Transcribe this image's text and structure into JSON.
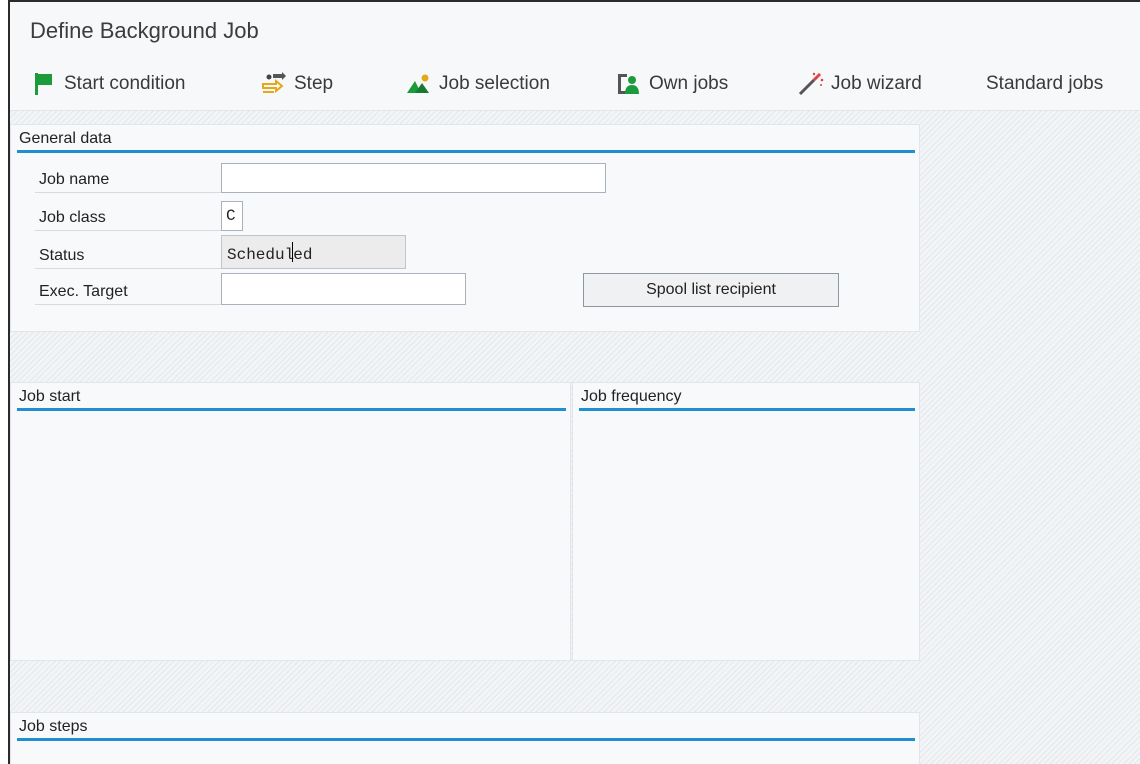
{
  "window": {
    "title": "Define Background Job"
  },
  "toolbar": {
    "start_condition": "Start condition",
    "step": "Step",
    "job_selection": "Job selection",
    "own_jobs": "Own jobs",
    "job_wizard": "Job wizard",
    "standard_jobs": "Standard jobs"
  },
  "general": {
    "heading": "General data",
    "job_name_label": "Job name",
    "job_name_value": "",
    "job_class_label": "Job class",
    "job_class_value": "C",
    "status_label": "Status",
    "status_value_a": "Schedul",
    "status_value_b": "ed",
    "exec_target_label": "Exec. Target",
    "exec_target_value": "",
    "spool_button": "Spool list recipient"
  },
  "job_start": {
    "heading": "Job start"
  },
  "job_frequency": {
    "heading": "Job frequency"
  },
  "job_steps": {
    "heading": "Job steps"
  },
  "colors": {
    "accent": "#1f8fd2",
    "flag": "#1c9b3c"
  }
}
